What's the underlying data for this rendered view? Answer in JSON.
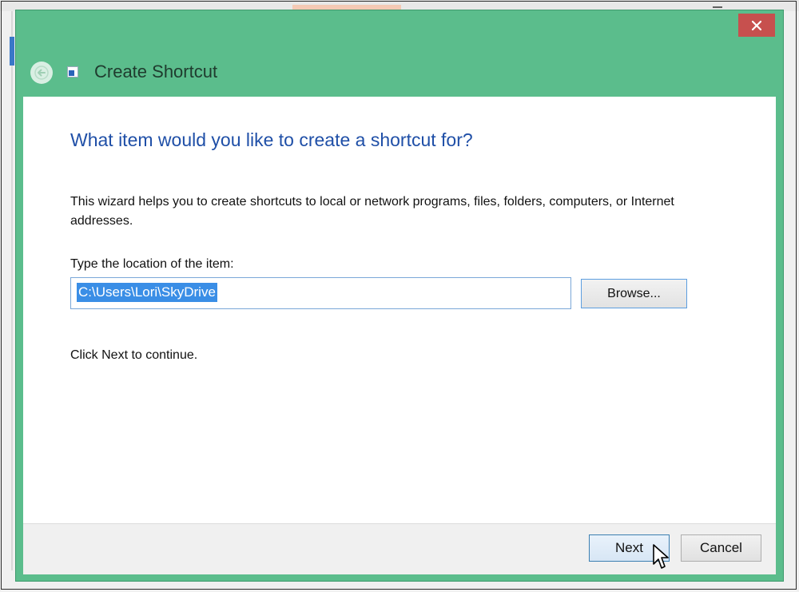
{
  "dialog": {
    "title": "Create Shortcut",
    "heading": "What item would you like to create a shortcut for?",
    "description": "This wizard helps you to create shortcuts to local or network programs, files, folders, computers, or Internet addresses.",
    "location_label": "Type the location of the item:",
    "location_value": "C:\\Users\\Lori\\SkyDrive",
    "browse_label": "Browse...",
    "continue_text": "Click Next to continue.",
    "next_label": "Next",
    "cancel_label": "Cancel"
  },
  "icons": {
    "back": "back-arrow-icon",
    "close": "close-icon",
    "shortcut": "shortcut-icon",
    "cursor": "mouse-pointer-icon"
  },
  "colors": {
    "title_bar": "#5bbd8c",
    "close_button": "#c7504e",
    "heading": "#1f4fa7",
    "selection": "#3a8ee6"
  }
}
